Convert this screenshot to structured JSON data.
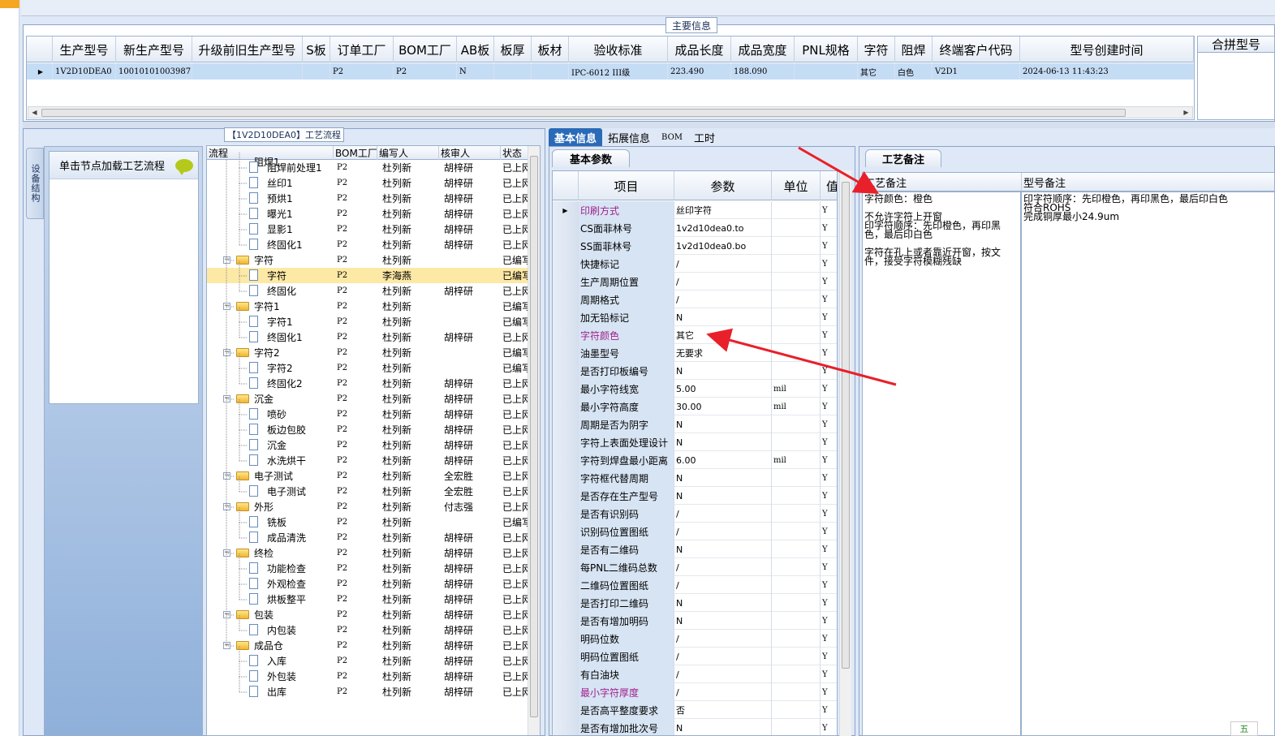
{
  "top": {
    "title": "主要信息",
    "hint": "1V2D10DEA0"
  },
  "main_grid": {
    "columns": [
      {
        "label": "生产型号",
        "w": 78
      },
      {
        "label": "新生产型号",
        "w": 94
      },
      {
        "label": "升级前旧生产型号",
        "w": 136
      },
      {
        "label": "S板",
        "w": 34
      },
      {
        "label": "订单工厂",
        "w": 78
      },
      {
        "label": "BOM工厂",
        "w": 78
      },
      {
        "label": "AB板",
        "w": 46
      },
      {
        "label": "板厚",
        "w": 46
      },
      {
        "label": "板材",
        "w": 46
      },
      {
        "label": "验收标准",
        "w": 122
      },
      {
        "label": "成品长度",
        "w": 78
      },
      {
        "label": "成品宽度",
        "w": 78
      },
      {
        "label": "PNL规格",
        "w": 78
      },
      {
        "label": "字符",
        "w": 46
      },
      {
        "label": "阻焊",
        "w": 46
      },
      {
        "label": "终端客户代码",
        "w": 108
      },
      {
        "label": "型号创建时间",
        "w": 214
      }
    ],
    "row": [
      "1V2D10DEA0",
      "10010101003987",
      "",
      "",
      "P2",
      "P2",
      "N",
      "",
      "",
      "IPC-6012 III级",
      "223.490",
      "188.090",
      "",
      "其它",
      "白色",
      "V2D1",
      "2024-06-13 11:43:23"
    ],
    "merge_header": "合拼型号"
  },
  "process": {
    "legend": "【1V2D10DEA0】工艺流程",
    "vertical_tab": "设备结构",
    "load_hint": "单击节点加载工艺流程",
    "columns": [
      "流程",
      "BOM工厂",
      "编写人",
      "核审人",
      "状态"
    ],
    "rows": [
      {
        "name": "阻焊前处理1",
        "level": 2,
        "type": "doc",
        "bom": "P2",
        "author": "杜列新",
        "reviewer": "胡梓研",
        "status": "已上网"
      },
      {
        "name": "丝印1",
        "level": 2,
        "type": "doc",
        "bom": "P2",
        "author": "杜列新",
        "reviewer": "胡梓研",
        "status": "已上网"
      },
      {
        "name": "预烘1",
        "level": 2,
        "type": "doc",
        "bom": "P2",
        "author": "杜列新",
        "reviewer": "胡梓研",
        "status": "已上网"
      },
      {
        "name": "曝光1",
        "level": 2,
        "type": "doc",
        "bom": "P2",
        "author": "杜列新",
        "reviewer": "胡梓研",
        "status": "已上网"
      },
      {
        "name": "显影1",
        "level": 2,
        "type": "doc",
        "bom": "P2",
        "author": "杜列新",
        "reviewer": "胡梓研",
        "status": "已上网"
      },
      {
        "name": "终固化1",
        "level": 2,
        "type": "doc",
        "bom": "P2",
        "author": "杜列新",
        "reviewer": "胡梓研",
        "status": "已上网"
      },
      {
        "name": "字符",
        "level": 1,
        "type": "folder",
        "bom": "P2",
        "author": "杜列新",
        "reviewer": "",
        "status": "已编写"
      },
      {
        "name": "字符",
        "level": 2,
        "type": "doc",
        "bom": "P2",
        "author": "李海燕",
        "reviewer": "",
        "status": "已编写",
        "selected": true
      },
      {
        "name": "终固化",
        "level": 2,
        "type": "doc",
        "bom": "P2",
        "author": "杜列新",
        "reviewer": "胡梓研",
        "status": "已上网"
      },
      {
        "name": "字符1",
        "level": 1,
        "type": "folder",
        "bom": "P2",
        "author": "杜列新",
        "reviewer": "",
        "status": "已编写"
      },
      {
        "name": "字符1",
        "level": 2,
        "type": "doc",
        "bom": "P2",
        "author": "杜列新",
        "reviewer": "",
        "status": "已编写"
      },
      {
        "name": "终固化1",
        "level": 2,
        "type": "doc",
        "bom": "P2",
        "author": "杜列新",
        "reviewer": "胡梓研",
        "status": "已上网"
      },
      {
        "name": "字符2",
        "level": 1,
        "type": "folder",
        "bom": "P2",
        "author": "杜列新",
        "reviewer": "",
        "status": "已编写"
      },
      {
        "name": "字符2",
        "level": 2,
        "type": "doc",
        "bom": "P2",
        "author": "杜列新",
        "reviewer": "",
        "status": "已编写"
      },
      {
        "name": "终固化2",
        "level": 2,
        "type": "doc",
        "bom": "P2",
        "author": "杜列新",
        "reviewer": "胡梓研",
        "status": "已上网"
      },
      {
        "name": "沉金",
        "level": 1,
        "type": "folder",
        "bom": "P2",
        "author": "杜列新",
        "reviewer": "胡梓研",
        "status": "已上网"
      },
      {
        "name": "喷砂",
        "level": 2,
        "type": "doc",
        "bom": "P2",
        "author": "杜列新",
        "reviewer": "胡梓研",
        "status": "已上网"
      },
      {
        "name": "板边包胶",
        "level": 2,
        "type": "doc",
        "bom": "P2",
        "author": "杜列新",
        "reviewer": "胡梓研",
        "status": "已上网"
      },
      {
        "name": "沉金",
        "level": 2,
        "type": "doc",
        "bom": "P2",
        "author": "杜列新",
        "reviewer": "胡梓研",
        "status": "已上网"
      },
      {
        "name": "水洗烘干",
        "level": 2,
        "type": "doc",
        "bom": "P2",
        "author": "杜列新",
        "reviewer": "胡梓研",
        "status": "已上网"
      },
      {
        "name": "电子测试",
        "level": 1,
        "type": "folder",
        "bom": "P2",
        "author": "杜列新",
        "reviewer": "全宏胜",
        "status": "已上网"
      },
      {
        "name": "电子测试",
        "level": 2,
        "type": "doc",
        "bom": "P2",
        "author": "杜列新",
        "reviewer": "全宏胜",
        "status": "已上网"
      },
      {
        "name": "外形",
        "level": 1,
        "type": "folder",
        "bom": "P2",
        "author": "杜列新",
        "reviewer": "付志强",
        "status": "已上网"
      },
      {
        "name": "铣板",
        "level": 2,
        "type": "doc",
        "bom": "P2",
        "author": "杜列新",
        "reviewer": "",
        "status": "已编写"
      },
      {
        "name": "成品清洗",
        "level": 2,
        "type": "doc",
        "bom": "P2",
        "author": "杜列新",
        "reviewer": "胡梓研",
        "status": "已上网"
      },
      {
        "name": "终检",
        "level": 1,
        "type": "folder",
        "bom": "P2",
        "author": "杜列新",
        "reviewer": "胡梓研",
        "status": "已上网"
      },
      {
        "name": "功能检查",
        "level": 2,
        "type": "doc",
        "bom": "P2",
        "author": "杜列新",
        "reviewer": "胡梓研",
        "status": "已上网"
      },
      {
        "name": "外观检查",
        "level": 2,
        "type": "doc",
        "bom": "P2",
        "author": "杜列新",
        "reviewer": "胡梓研",
        "status": "已上网"
      },
      {
        "name": "烘板整平",
        "level": 2,
        "type": "doc",
        "bom": "P2",
        "author": "杜列新",
        "reviewer": "胡梓研",
        "status": "已上网"
      },
      {
        "name": "包装",
        "level": 1,
        "type": "folder",
        "bom": "P2",
        "author": "杜列新",
        "reviewer": "胡梓研",
        "status": "已上网"
      },
      {
        "name": "内包装",
        "level": 2,
        "type": "doc",
        "bom": "P2",
        "author": "杜列新",
        "reviewer": "胡梓研",
        "status": "已上网"
      },
      {
        "name": "成品仓",
        "level": 1,
        "type": "folder",
        "bom": "P2",
        "author": "杜列新",
        "reviewer": "胡梓研",
        "status": "已上网"
      },
      {
        "name": "入库",
        "level": 2,
        "type": "doc",
        "bom": "P2",
        "author": "杜列新",
        "reviewer": "胡梓研",
        "status": "已上网"
      },
      {
        "name": "外包装",
        "level": 2,
        "type": "doc",
        "bom": "P2",
        "author": "杜列新",
        "reviewer": "胡梓研",
        "status": "已上网"
      },
      {
        "name": "出库",
        "level": 2,
        "type": "doc",
        "bom": "P2",
        "author": "杜列新",
        "reviewer": "胡梓研",
        "status": "已上网"
      }
    ],
    "partial_top_row": "阻焊1"
  },
  "basic": {
    "tabs": [
      "基本信息",
      "拓展信息",
      "BOM",
      "工时"
    ],
    "subtab": "基本参数",
    "columns": [
      "项目",
      "参数",
      "单位",
      "值"
    ],
    "rows": [
      {
        "item": "印刷方式",
        "param": "丝印字符",
        "unit": "",
        "flag": "Y",
        "hl": true,
        "current": true
      },
      {
        "item": "CS面菲林号",
        "param": "1v2d10dea0.to",
        "unit": "",
        "flag": "Y"
      },
      {
        "item": "SS面菲林号",
        "param": "1v2d10dea0.bo",
        "unit": "",
        "flag": "Y"
      },
      {
        "item": "快捷标记",
        "param": "/",
        "unit": "",
        "flag": "Y"
      },
      {
        "item": "生产周期位置",
        "param": "/",
        "unit": "",
        "flag": "Y"
      },
      {
        "item": "周期格式",
        "param": "/",
        "unit": "",
        "flag": "Y"
      },
      {
        "item": "加无铅标记",
        "param": "N",
        "unit": "",
        "flag": "Y"
      },
      {
        "item": "字符颜色",
        "param": "其它",
        "unit": "",
        "flag": "Y",
        "hl": true
      },
      {
        "item": "油墨型号",
        "param": "无要求",
        "unit": "",
        "flag": "Y"
      },
      {
        "item": "是否打印板编号",
        "param": "N",
        "unit": "",
        "flag": "Y"
      },
      {
        "item": "最小字符线宽",
        "param": "5.00",
        "unit": "mil",
        "flag": "Y"
      },
      {
        "item": "最小字符高度",
        "param": "30.00",
        "unit": "mil",
        "flag": "Y"
      },
      {
        "item": "周期是否为阴字",
        "param": "N",
        "unit": "",
        "flag": "Y"
      },
      {
        "item": "字符上表面处理设计",
        "param": "N",
        "unit": "",
        "flag": "Y"
      },
      {
        "item": "字符到焊盘最小距离",
        "param": "6.00",
        "unit": "mil",
        "flag": "Y"
      },
      {
        "item": "字符框代替周期",
        "param": "N",
        "unit": "",
        "flag": "Y"
      },
      {
        "item": "是否存在生产型号",
        "param": "N",
        "unit": "",
        "flag": "Y"
      },
      {
        "item": "是否有识别码",
        "param": "/",
        "unit": "",
        "flag": "Y"
      },
      {
        "item": "识别码位置图纸",
        "param": "/",
        "unit": "",
        "flag": "Y"
      },
      {
        "item": "是否有二维码",
        "param": "N",
        "unit": "",
        "flag": "Y"
      },
      {
        "item": "每PNL二维码总数",
        "param": "/",
        "unit": "",
        "flag": "Y"
      },
      {
        "item": "二维码位置图纸",
        "param": "/",
        "unit": "",
        "flag": "Y"
      },
      {
        "item": "是否打印二维码",
        "param": "N",
        "unit": "",
        "flag": "Y"
      },
      {
        "item": "是否有增加明码",
        "param": "N",
        "unit": "",
        "flag": "Y"
      },
      {
        "item": "明码位数",
        "param": "/",
        "unit": "",
        "flag": "Y"
      },
      {
        "item": "明码位置图纸",
        "param": "/",
        "unit": "",
        "flag": "Y"
      },
      {
        "item": "有白油块",
        "param": "/",
        "unit": "",
        "flag": "Y"
      },
      {
        "item": "最小字符厚度",
        "param": "/",
        "unit": "",
        "flag": "Y",
        "hl": true
      },
      {
        "item": "是否高平整度要求",
        "param": "否",
        "unit": "",
        "flag": "Y"
      },
      {
        "item": "是否有增加批次号",
        "param": "N",
        "unit": "",
        "flag": "Y"
      }
    ]
  },
  "notes": {
    "tab": "工艺备注",
    "col1": "工艺备注",
    "col2": "型号备注",
    "process_note": [
      "字符颜色：橙色",
      "",
      "不允许字符上开窗",
      "印字符顺序：先印橙色，再印黑",
      "色，最后印白色",
      "",
      "字符在孔上或者靠近开窗，按文",
      "件，接受字符模糊残缺"
    ],
    "model_note": [
      "印字符顺序：先印橙色，再印黑色，最后印白色",
      "符合ROHS",
      "完成铜厚最小24.9um"
    ]
  },
  "colors": {
    "highlight_text": "#a0208c",
    "accent": "#2a6ab8",
    "arrow": "#e8202a",
    "selected_row": "#fde9a6"
  },
  "corner": "五"
}
